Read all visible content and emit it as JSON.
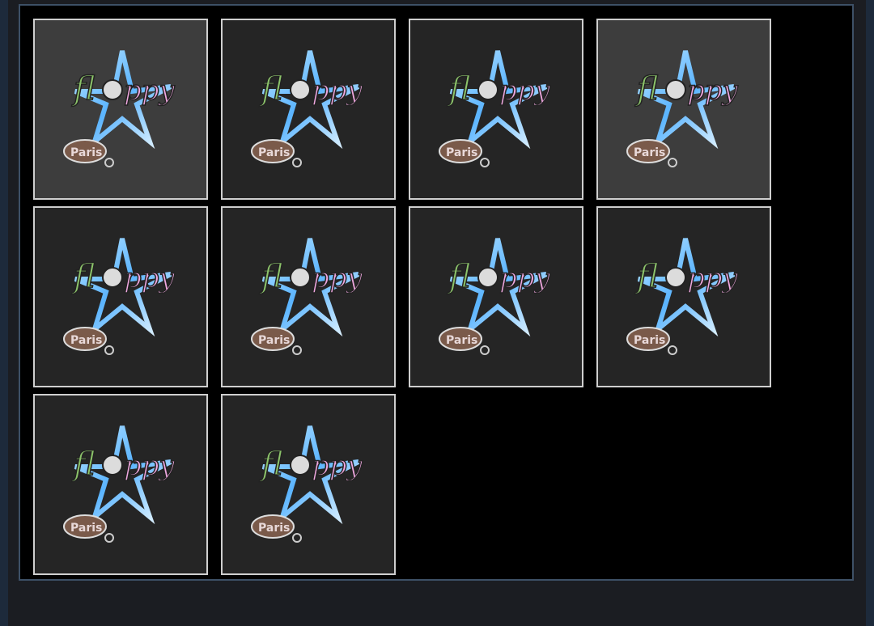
{
  "gallery": {
    "items": [
      {
        "logo_word": "floppy",
        "badge_word": "Paris",
        "selected": true
      },
      {
        "logo_word": "floppy",
        "badge_word": "Paris",
        "selected": false
      },
      {
        "logo_word": "floppy",
        "badge_word": "Paris",
        "selected": false
      },
      {
        "logo_word": "floppy",
        "badge_word": "Paris",
        "selected": true
      },
      {
        "logo_word": "floppy",
        "badge_word": "Paris",
        "selected": false
      },
      {
        "logo_word": "floppy",
        "badge_word": "Paris",
        "selected": false
      },
      {
        "logo_word": "floppy",
        "badge_word": "Paris",
        "selected": false
      },
      {
        "logo_word": "floppy",
        "badge_word": "Paris",
        "selected": false
      },
      {
        "logo_word": "floppy",
        "badge_word": "Paris",
        "selected": false
      },
      {
        "logo_word": "floppy",
        "badge_word": "Paris",
        "selected": false
      }
    ]
  },
  "colors": {
    "panel_border": "#3d5066",
    "tile_border": "#cfcfcf",
    "star_blue": "#5ab4ff",
    "logo_green": "#8cc36a",
    "logo_pink": "#f0a8e0"
  }
}
